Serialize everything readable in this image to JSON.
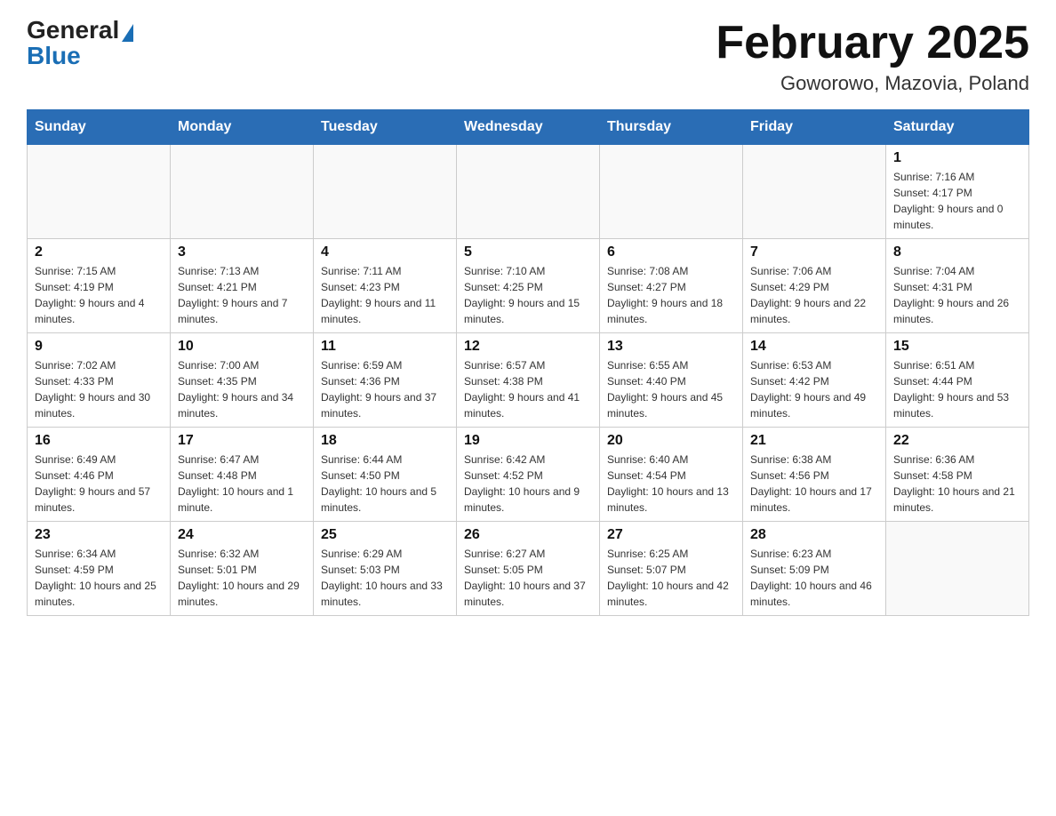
{
  "header": {
    "logo_general": "General",
    "logo_blue": "Blue",
    "month_title": "February 2025",
    "location": "Goworowo, Mazovia, Poland"
  },
  "days_of_week": [
    "Sunday",
    "Monday",
    "Tuesday",
    "Wednesday",
    "Thursday",
    "Friday",
    "Saturday"
  ],
  "weeks": [
    [
      {
        "day": "",
        "info": ""
      },
      {
        "day": "",
        "info": ""
      },
      {
        "day": "",
        "info": ""
      },
      {
        "day": "",
        "info": ""
      },
      {
        "day": "",
        "info": ""
      },
      {
        "day": "",
        "info": ""
      },
      {
        "day": "1",
        "info": "Sunrise: 7:16 AM\nSunset: 4:17 PM\nDaylight: 9 hours and 0 minutes."
      }
    ],
    [
      {
        "day": "2",
        "info": "Sunrise: 7:15 AM\nSunset: 4:19 PM\nDaylight: 9 hours and 4 minutes."
      },
      {
        "day": "3",
        "info": "Sunrise: 7:13 AM\nSunset: 4:21 PM\nDaylight: 9 hours and 7 minutes."
      },
      {
        "day": "4",
        "info": "Sunrise: 7:11 AM\nSunset: 4:23 PM\nDaylight: 9 hours and 11 minutes."
      },
      {
        "day": "5",
        "info": "Sunrise: 7:10 AM\nSunset: 4:25 PM\nDaylight: 9 hours and 15 minutes."
      },
      {
        "day": "6",
        "info": "Sunrise: 7:08 AM\nSunset: 4:27 PM\nDaylight: 9 hours and 18 minutes."
      },
      {
        "day": "7",
        "info": "Sunrise: 7:06 AM\nSunset: 4:29 PM\nDaylight: 9 hours and 22 minutes."
      },
      {
        "day": "8",
        "info": "Sunrise: 7:04 AM\nSunset: 4:31 PM\nDaylight: 9 hours and 26 minutes."
      }
    ],
    [
      {
        "day": "9",
        "info": "Sunrise: 7:02 AM\nSunset: 4:33 PM\nDaylight: 9 hours and 30 minutes."
      },
      {
        "day": "10",
        "info": "Sunrise: 7:00 AM\nSunset: 4:35 PM\nDaylight: 9 hours and 34 minutes."
      },
      {
        "day": "11",
        "info": "Sunrise: 6:59 AM\nSunset: 4:36 PM\nDaylight: 9 hours and 37 minutes."
      },
      {
        "day": "12",
        "info": "Sunrise: 6:57 AM\nSunset: 4:38 PM\nDaylight: 9 hours and 41 minutes."
      },
      {
        "day": "13",
        "info": "Sunrise: 6:55 AM\nSunset: 4:40 PM\nDaylight: 9 hours and 45 minutes."
      },
      {
        "day": "14",
        "info": "Sunrise: 6:53 AM\nSunset: 4:42 PM\nDaylight: 9 hours and 49 minutes."
      },
      {
        "day": "15",
        "info": "Sunrise: 6:51 AM\nSunset: 4:44 PM\nDaylight: 9 hours and 53 minutes."
      }
    ],
    [
      {
        "day": "16",
        "info": "Sunrise: 6:49 AM\nSunset: 4:46 PM\nDaylight: 9 hours and 57 minutes."
      },
      {
        "day": "17",
        "info": "Sunrise: 6:47 AM\nSunset: 4:48 PM\nDaylight: 10 hours and 1 minute."
      },
      {
        "day": "18",
        "info": "Sunrise: 6:44 AM\nSunset: 4:50 PM\nDaylight: 10 hours and 5 minutes."
      },
      {
        "day": "19",
        "info": "Sunrise: 6:42 AM\nSunset: 4:52 PM\nDaylight: 10 hours and 9 minutes."
      },
      {
        "day": "20",
        "info": "Sunrise: 6:40 AM\nSunset: 4:54 PM\nDaylight: 10 hours and 13 minutes."
      },
      {
        "day": "21",
        "info": "Sunrise: 6:38 AM\nSunset: 4:56 PM\nDaylight: 10 hours and 17 minutes."
      },
      {
        "day": "22",
        "info": "Sunrise: 6:36 AM\nSunset: 4:58 PM\nDaylight: 10 hours and 21 minutes."
      }
    ],
    [
      {
        "day": "23",
        "info": "Sunrise: 6:34 AM\nSunset: 4:59 PM\nDaylight: 10 hours and 25 minutes."
      },
      {
        "day": "24",
        "info": "Sunrise: 6:32 AM\nSunset: 5:01 PM\nDaylight: 10 hours and 29 minutes."
      },
      {
        "day": "25",
        "info": "Sunrise: 6:29 AM\nSunset: 5:03 PM\nDaylight: 10 hours and 33 minutes."
      },
      {
        "day": "26",
        "info": "Sunrise: 6:27 AM\nSunset: 5:05 PM\nDaylight: 10 hours and 37 minutes."
      },
      {
        "day": "27",
        "info": "Sunrise: 6:25 AM\nSunset: 5:07 PM\nDaylight: 10 hours and 42 minutes."
      },
      {
        "day": "28",
        "info": "Sunrise: 6:23 AM\nSunset: 5:09 PM\nDaylight: 10 hours and 46 minutes."
      },
      {
        "day": "",
        "info": ""
      }
    ]
  ]
}
